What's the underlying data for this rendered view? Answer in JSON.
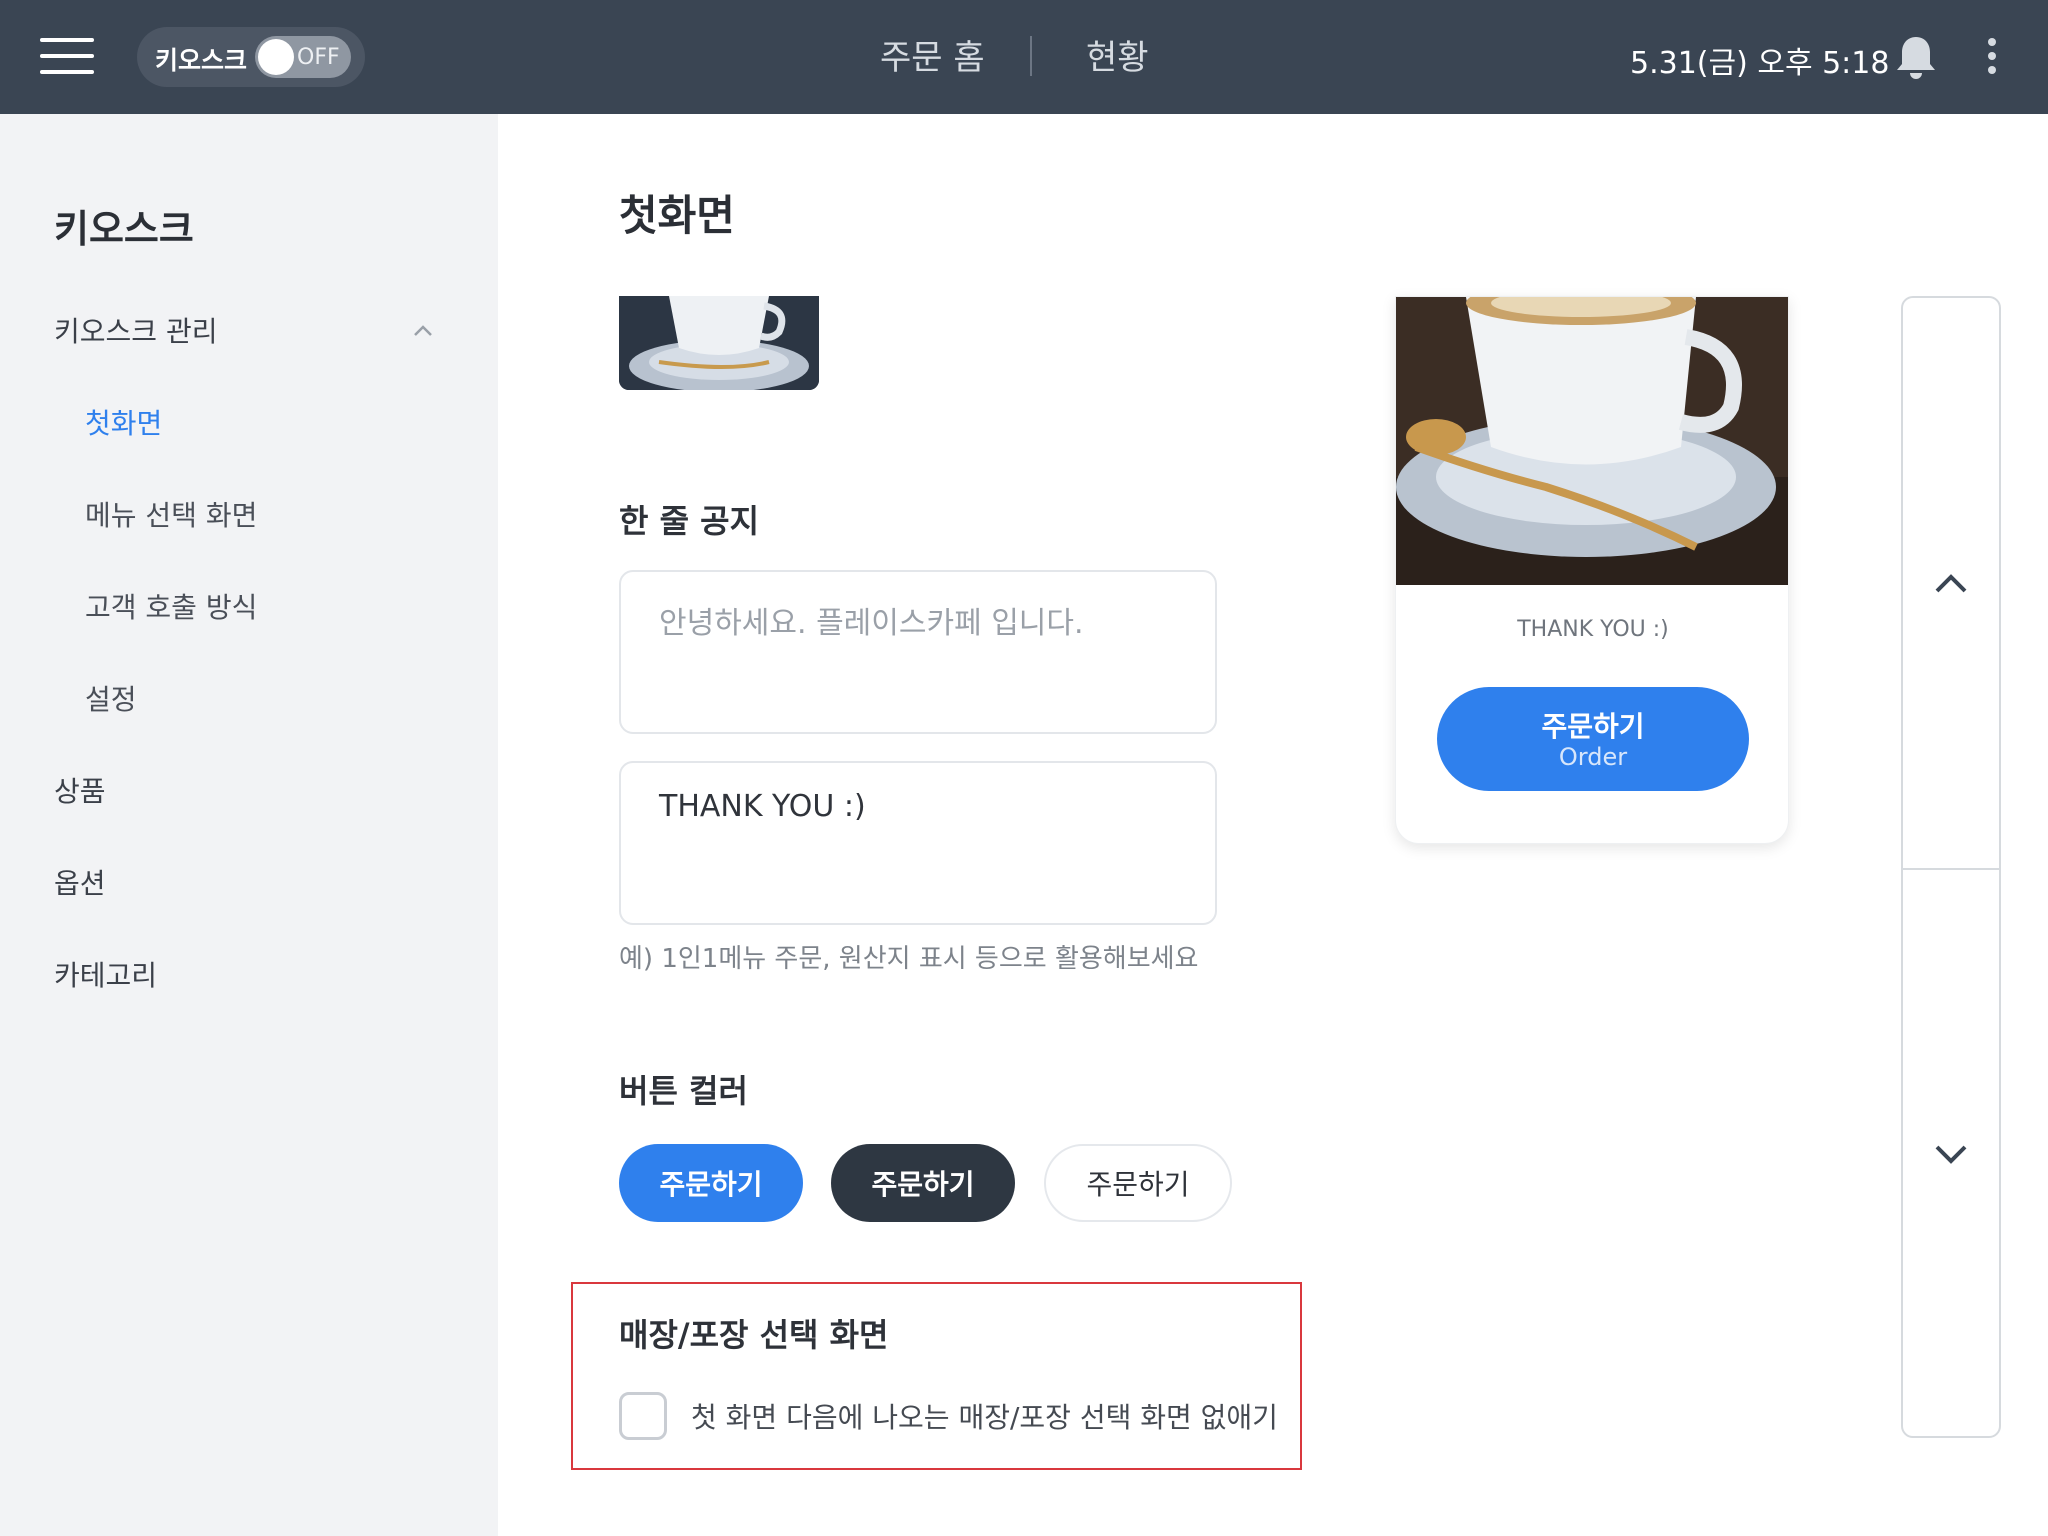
{
  "header": {
    "kiosk_label": "키오스크",
    "kiosk_toggle_state": "OFF",
    "tabs": [
      {
        "label": "주문 홈"
      },
      {
        "label": "현황"
      }
    ],
    "datetime": "5.31(금) 오후 5:18"
  },
  "sidebar": {
    "title": "키오스크",
    "items": [
      {
        "label": "키오스크 관리"
      },
      {
        "label": "첫화면"
      },
      {
        "label": "메뉴 선택 화면"
      },
      {
        "label": "고객 호출 방식"
      },
      {
        "label": "설정"
      },
      {
        "label": "상품"
      },
      {
        "label": "옵션"
      },
      {
        "label": "카테고리"
      }
    ]
  },
  "main": {
    "title": "첫화면",
    "notice": {
      "title": "한 줄 공지",
      "line1_placeholder": "안녕하세요. 플레이스카페 입니다.",
      "line2_value": "THANK YOU :)",
      "hint": "예) 1인1메뉴 주문, 원산지 표시 등으로 활용해보세요"
    },
    "button_color": {
      "title": "버튼 컬러",
      "options": [
        {
          "label": "주문하기",
          "color": "#2f80ed"
        },
        {
          "label": "주문하기",
          "color": "#2e3742"
        },
        {
          "label": "주문하기",
          "color": "#ffffff"
        }
      ]
    },
    "store_pickup": {
      "title": "매장/포장 선택 화면",
      "checkbox_label": "첫 화면 다음에 나오는 매장/포장 선택 화면 없애기"
    }
  },
  "preview": {
    "notice_text": "THANK YOU :)",
    "order_ko": "주문하기",
    "order_en": "Order"
  },
  "colors": {
    "topbar": "#3a4553",
    "accent": "#2f80ed",
    "sidebar_bg": "#f2f3f5",
    "highlight": "#d9383e"
  }
}
